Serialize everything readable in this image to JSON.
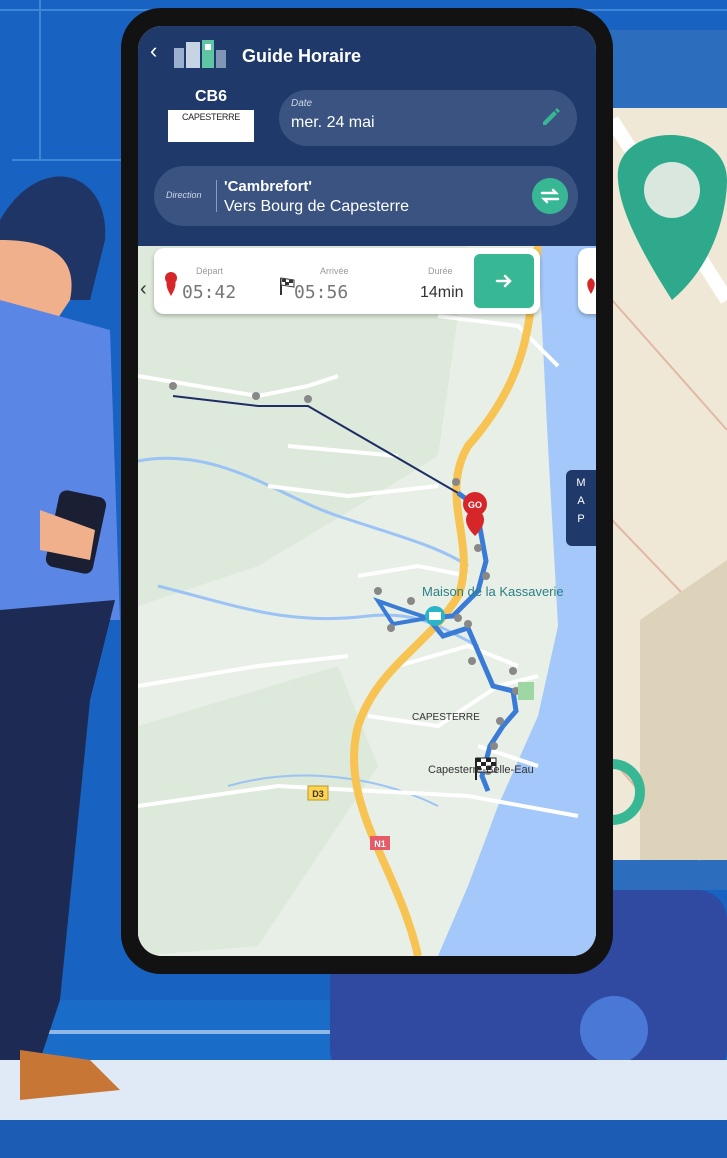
{
  "app": {
    "title": "Guide Horaire",
    "back_icon": "chevron-left-icon"
  },
  "line": {
    "code": "CB6",
    "destination": "CAPESTERRE"
  },
  "date": {
    "label": "Date",
    "value": "mer. 24 mai",
    "edit_icon": "pencil-icon"
  },
  "direction": {
    "label": "Direction",
    "name": "'Cambrefort'",
    "sub": "Vers Bourg de Capesterre",
    "swap_icon": "swap-icon"
  },
  "trip": {
    "departure_label": "Départ",
    "departure_time": "05:42",
    "arrival_label": "Arrivée",
    "arrival_time": "05:56",
    "duration_label": "Durée",
    "duration_value": "14min",
    "go_icon": "arrow-right-icon"
  },
  "map": {
    "tab_letters": [
      "M",
      "A",
      "P"
    ],
    "labels": {
      "poi": "Maison de la Kassaverie",
      "town": "CAPESTERRE",
      "city": "Capesterre-Belle-Eau",
      "road_d3": "D3",
      "road_n1": "N1",
      "go_badge": "GO"
    }
  },
  "colors": {
    "header": "#20396b",
    "pill": "#3a5380",
    "accent": "#37b794",
    "route": "#3a7bd5",
    "water": "#a4c8fa",
    "road": "#f7c453"
  }
}
